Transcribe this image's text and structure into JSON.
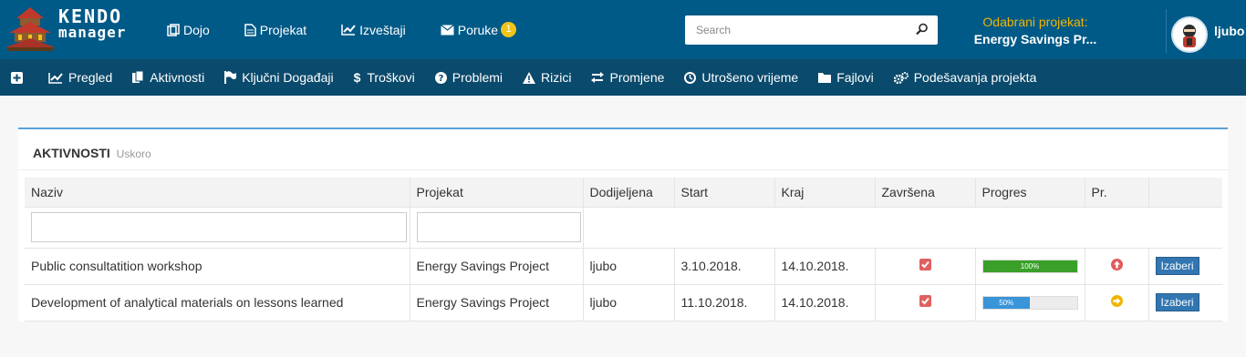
{
  "app": {
    "logo_line1": "KENDO",
    "logo_line2": "manager"
  },
  "topnav": {
    "items": [
      {
        "label": "Dojo",
        "icon": "copy-icon"
      },
      {
        "label": "Projekat",
        "icon": "document-icon"
      },
      {
        "label": "Izveštaji",
        "icon": "line-chart-icon"
      },
      {
        "label": "Poruke",
        "icon": "envelope-icon",
        "badge": "1"
      }
    ]
  },
  "search": {
    "placeholder": "Search",
    "value": ""
  },
  "selected_project": {
    "label": "Odabrani projekat:",
    "value": "Energy Savings Pr..."
  },
  "user": {
    "name": "ljubo"
  },
  "subnav": {
    "items": [
      {
        "label": "",
        "icon": "plus-square-icon"
      },
      {
        "label": "Pregled",
        "icon": "line-chart-icon"
      },
      {
        "label": "Aktivnosti",
        "icon": "files-icon"
      },
      {
        "label": "Ključni Događaji",
        "icon": "flag-icon"
      },
      {
        "label": "Troškovi",
        "icon": "dollar-icon"
      },
      {
        "label": "Problemi",
        "icon": "question-circle-icon"
      },
      {
        "label": "Rizici",
        "icon": "warning-icon"
      },
      {
        "label": "Promjene",
        "icon": "exchange-icon"
      },
      {
        "label": "Utrošeno vrijeme",
        "icon": "clock-icon"
      },
      {
        "label": "Fajlovi",
        "icon": "folder-icon"
      },
      {
        "label": "Podešavanja projekta",
        "icon": "cogs-icon"
      }
    ]
  },
  "panel": {
    "title": "AKTIVNOSTI",
    "subtitle": "Uskoro"
  },
  "table": {
    "columns": [
      "Naziv",
      "Projekat",
      "Dodijeljena",
      "Start",
      "Kraj",
      "Završena",
      "Progres",
      "Pr.",
      ""
    ],
    "rows": [
      {
        "naziv": "Public consultatition workshop",
        "projekat": "Energy Savings Project",
        "dodijeljena": "ljubo",
        "start": "3.10.2018.",
        "kraj": "14.10.2018.",
        "zavrsena": true,
        "progress": 100,
        "progress_label": "100%",
        "progress_color": "#3aa02a",
        "priority_icon": "arrow-up-circle-icon",
        "priority_color": "#e05a5a",
        "action_label": "Izaberi"
      },
      {
        "naziv": "Development of analytical materials on lessons learned",
        "projekat": "Energy Savings Project",
        "dodijeljena": "ljubo",
        "start": "11.10.2018.",
        "kraj": "14.10.2018.",
        "zavrsena": true,
        "progress": 50,
        "progress_label": "50%",
        "progress_color": "#3a94d8",
        "priority_icon": "arrow-right-circle-icon",
        "priority_color": "#f0b400",
        "action_label": "Izaberi"
      }
    ]
  },
  "colors": {
    "topbar": "#005a87",
    "subnav": "#0a4a6c",
    "accent_yellow": "#f0b400",
    "button": "#3276b1"
  }
}
